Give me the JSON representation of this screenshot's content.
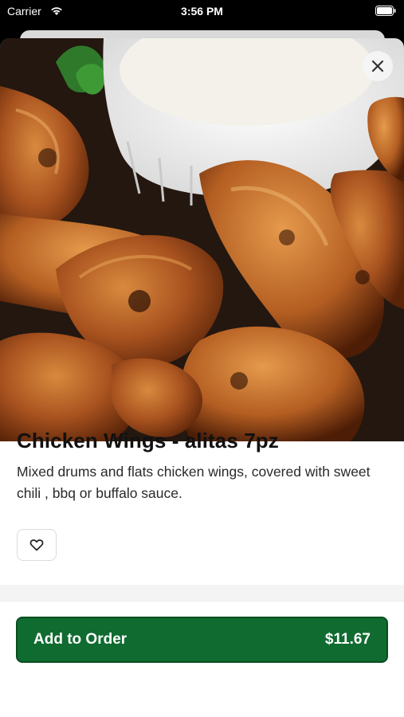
{
  "status_bar": {
    "carrier": "Carrier",
    "time": "3:56 PM",
    "icons": [
      "wifi-icon",
      "battery-icon"
    ]
  },
  "item": {
    "image": "chicken-wings-photo",
    "title": "Chicken Wings - alitas 7pz",
    "description": "Mixed drums and flats chicken wings, covered with sweet chili , bbq or buffalo sauce.",
    "favorite_icon": "heart-icon"
  },
  "close_icon": "close-icon",
  "order_button": {
    "label": "Add to Order",
    "price": "$11.67"
  },
  "colors": {
    "accent": "#0f6b2f",
    "accent_border": "#0a4d21",
    "text": "#111111"
  }
}
